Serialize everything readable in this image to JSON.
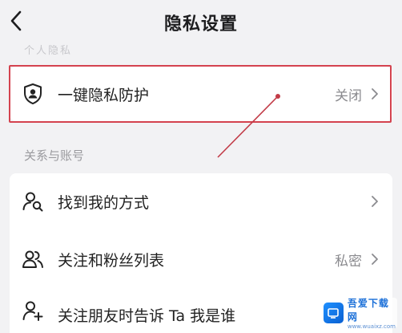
{
  "header": {
    "title": "隐私设置",
    "faded_section": "个人隐私"
  },
  "privacy_card": {
    "label": "一键隐私防护",
    "value": "关闭"
  },
  "relations_section": {
    "label": "关系与账号",
    "items": [
      {
        "label": "找到我的方式",
        "value": "",
        "icon": "search-user-icon"
      },
      {
        "label": "关注和粉丝列表",
        "value": "私密",
        "icon": "users-icon"
      },
      {
        "label": "关注朋友时告诉 Ta 我是谁",
        "value": "",
        "icon": "add-user-icon"
      }
    ]
  },
  "watermark": {
    "name": "吾爱下载网",
    "url": "www.wuaixz.com"
  },
  "colors": {
    "background": "#f2f2f4",
    "card": "#ffffff",
    "highlight": "#d4434f",
    "muted_text": "#8a8a8e"
  }
}
